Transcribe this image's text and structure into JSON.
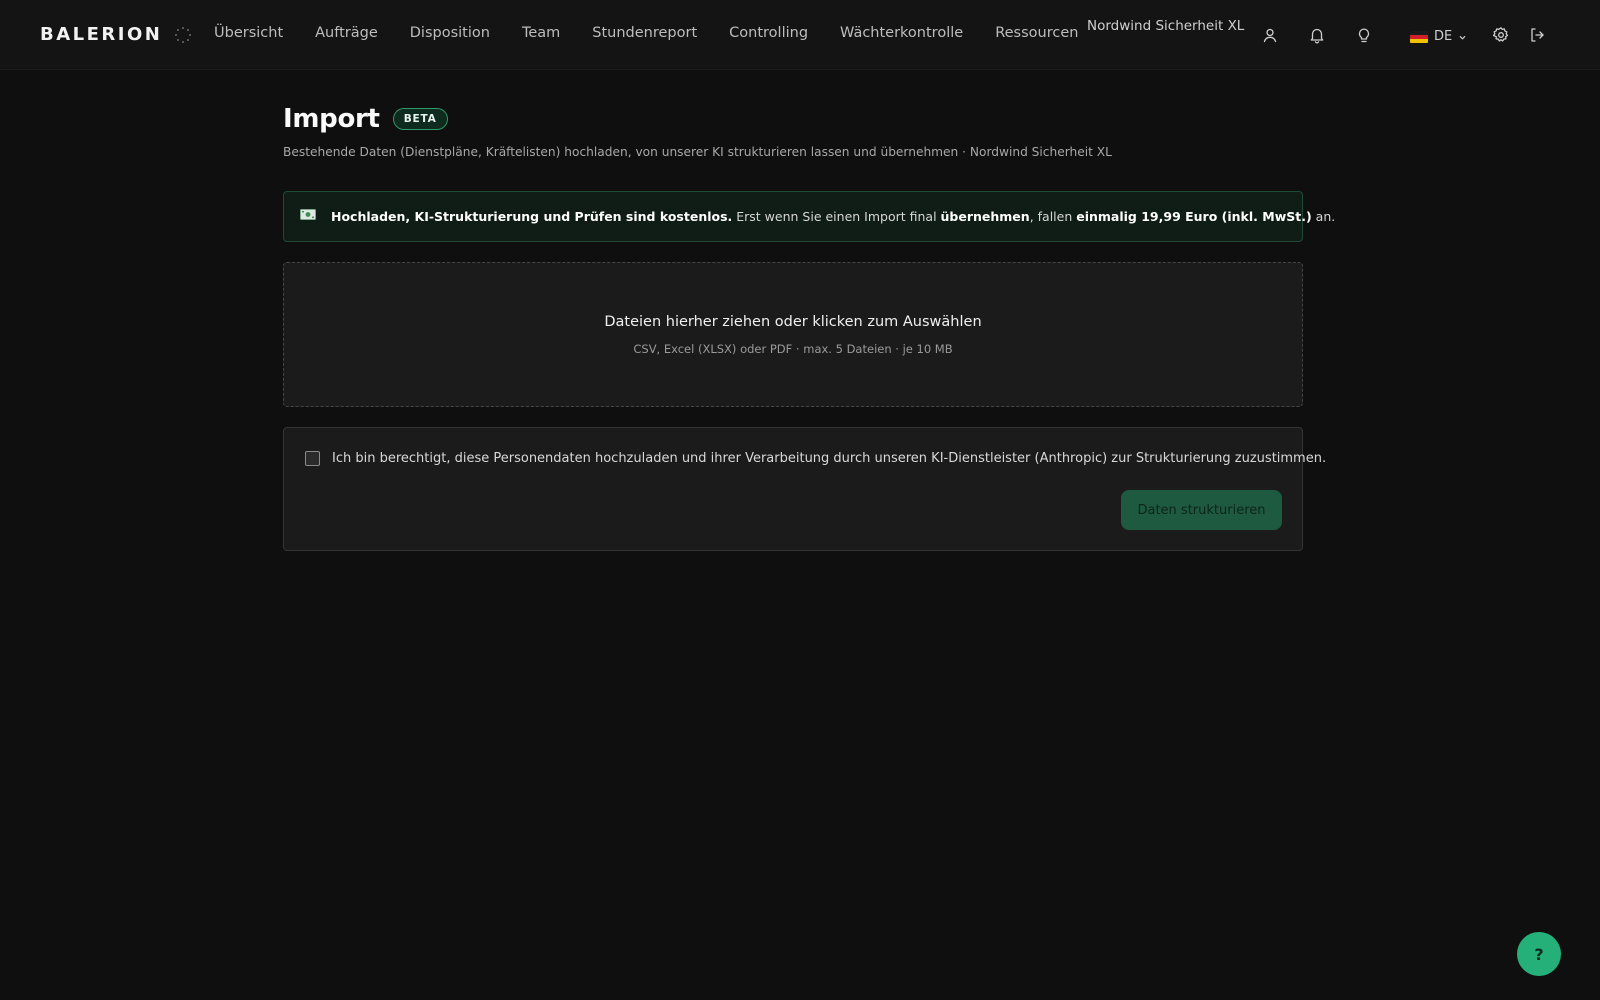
{
  "brand": {
    "name": "BALERION",
    "logo_icon": "dots-ring-icon"
  },
  "nav": {
    "items": [
      {
        "label": "Übersicht"
      },
      {
        "label": "Aufträge"
      },
      {
        "label": "Disposition"
      },
      {
        "label": "Team"
      },
      {
        "label": "Stundenreport"
      },
      {
        "label": "Controlling"
      },
      {
        "label": "Wächterkontrolle"
      },
      {
        "label": "Ressourcen"
      }
    ]
  },
  "header": {
    "company": "Nordwind Sicherheit XL",
    "icons": [
      "user-icon",
      "bell-icon",
      "lightbulb-icon",
      "gear-icon",
      "logout-icon"
    ],
    "language": {
      "label": "DE",
      "flag": "germany-flag-icon"
    }
  },
  "page": {
    "title": "Import",
    "badge": "BETA",
    "subtitle": "Bestehende Daten (Dienstpläne, Kräftelisten) hochladen, von unserer KI strukturieren lassen und übernehmen · Nordwind Sicherheit XL"
  },
  "notice": {
    "icon": "money-icon",
    "part1_bold": "Hochladen, KI-Strukturierung und Prüfen sind kostenlos.",
    "part2": " Erst wenn Sie einen Import final ",
    "part3_bold": "übernehmen",
    "part4": ", fallen ",
    "part5_bold": "einmalig 19,99 Euro (inkl. MwSt.)",
    "part6": " an."
  },
  "dropzone": {
    "title": "Dateien hierher ziehen oder klicken zum Auswählen",
    "subtitle": "CSV, Excel (XLSX) oder PDF · max. 5 Dateien · je 10 MB"
  },
  "consent": {
    "checked": false,
    "text": "Ich bin berechtigt, diese Personendaten hochzuladen und ihrer Verarbeitung durch unseren KI-Dienstleister (Anthropic) zur Strukturierung zuzustimmen.",
    "button_label": "Daten strukturieren"
  },
  "help": {
    "label": "?"
  },
  "colors": {
    "background": "#0f0f0f",
    "accent": "#25b07a",
    "button_disabled": "#1e5a3f",
    "notice_bg": "#0f1d16"
  }
}
